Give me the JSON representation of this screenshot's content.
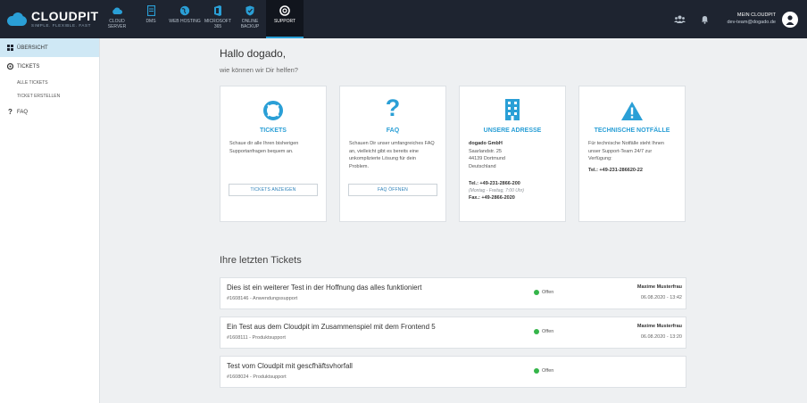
{
  "brand": {
    "name": "CLOUDPIT",
    "tagline": "SIMPLE. FLEXIBLE. FAST"
  },
  "nav": [
    {
      "label": "CLOUD SERVER",
      "icon": "cloud-icon"
    },
    {
      "label": "DMS",
      "icon": "document-icon"
    },
    {
      "label": "WEB HOSTING",
      "icon": "globe-icon"
    },
    {
      "label": "MICROSOFT 365",
      "icon": "office-icon"
    },
    {
      "label": "ONLINE BACKUP",
      "icon": "shield-icon"
    },
    {
      "label": "SUPPORT",
      "icon": "lifebuoy-icon",
      "active": true
    }
  ],
  "account": {
    "title": "MEIN CLOUDPIT",
    "email": "dev-team@dogado.de"
  },
  "sidebar": {
    "overview": "ÜBERSICHT",
    "tickets": "TICKETS",
    "all_tickets": "ALLE TICKETS",
    "create_ticket": "TICKET ERSTELLEN",
    "faq": "FAQ"
  },
  "greeting": {
    "title": "Hallo dogado,",
    "subtitle": "wie können wir Dir helfen?"
  },
  "cards": {
    "tickets": {
      "title": "TICKETS",
      "text": "Schaue dir alle Ihren bisherigen Supportanfragen bequem an.",
      "button": "TICKETS ANZEIGEN"
    },
    "faq": {
      "title": "FAQ",
      "text": "Schauen Dir unser umfangreiches FAQ an, vielleicht gibt es bereits eine unkomplizierte Lösung für dein Problem.",
      "button": "FAQ ÖFFNEN"
    },
    "address": {
      "title": "UNSERE ADRESSE",
      "company": "dogado GmbH",
      "street": "Saarlandstr. 25",
      "city": "44139 Dortmund",
      "country": "Deutschland",
      "tel": "Tel.: +49-231-2866-200",
      "hours": "(Montag - Freitag, 7:00 Uhr)",
      "fax": "Fax.: +49-2866-2020"
    },
    "emergency": {
      "title": "TECHNISCHE NOTFÄLLE",
      "text": "Für technische Notfälle steht Ihnen unser Support-Team 24/7 zur Verfügung:",
      "tel": "Tel.: +49-231-286620-22"
    }
  },
  "tickets_heading": "Ihre letzten Tickets",
  "tickets": [
    {
      "title": "Dies ist ein weiterer Test in der Hoffnung das alles funktioniert",
      "meta": "#1608146 - Anwendungssupport",
      "status": "Offen",
      "user": "Maxime Musterfrau",
      "date": "06.08.2020 - 13:42"
    },
    {
      "title": "Ein Test aus dem Cloudpit im Zusammenspiel mit dem Frontend 5",
      "meta": "#1608111 - Produktsupport",
      "status": "Offen",
      "user": "Maxime Musterfrau",
      "date": "06.08.2020 - 13:20"
    },
    {
      "title": "Test vom Cloudpit mit gescfhäftsvhorfall",
      "meta": "#1608024 - Produktsupport",
      "status": "Offen",
      "user": "",
      "date": ""
    }
  ],
  "colors": {
    "accent": "#2a9fd6",
    "topbar": "#1e2430",
    "status_open": "#35b54a"
  }
}
